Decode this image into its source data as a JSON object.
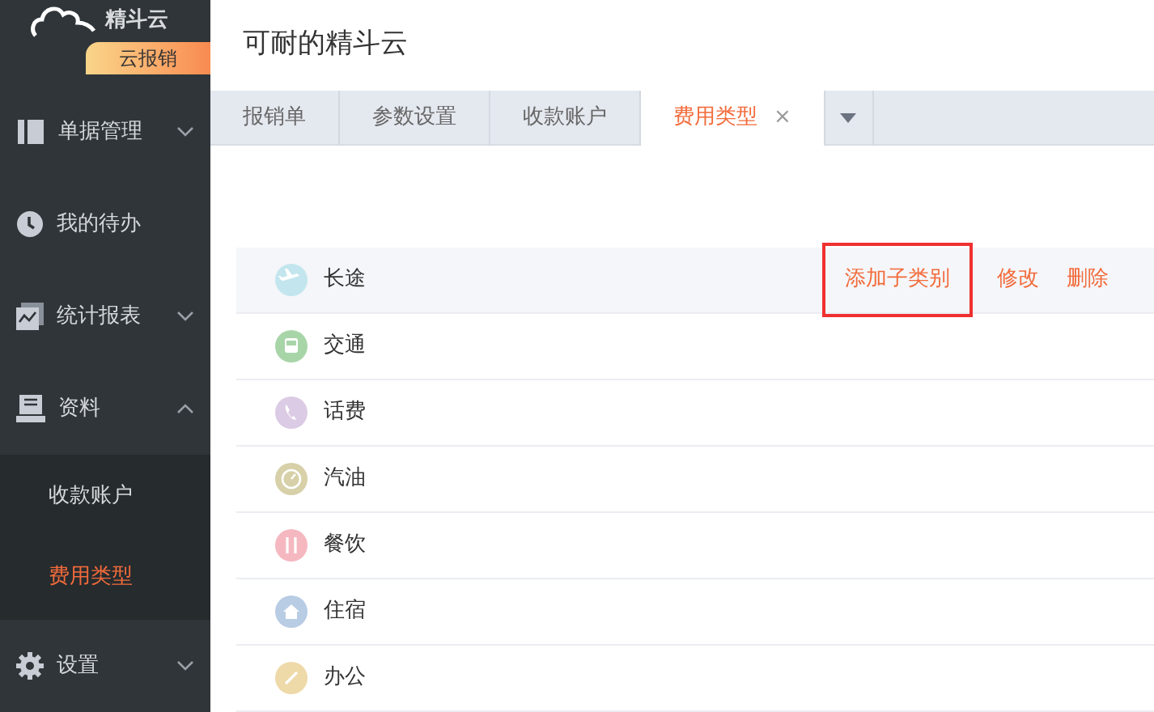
{
  "sidebar": {
    "logo": "精斗云",
    "badge": "云报销",
    "items": [
      {
        "label": "单据管理",
        "expanded": false
      },
      {
        "label": "我的待办"
      },
      {
        "label": "统计报表",
        "expanded": false
      },
      {
        "label": "资料",
        "expanded": true,
        "children": [
          {
            "label": "收款账户",
            "selected": false
          },
          {
            "label": "费用类型",
            "selected": true
          }
        ]
      },
      {
        "label": "设置",
        "expanded": false
      }
    ]
  },
  "header": {
    "title": "可耐的精斗云"
  },
  "tabs": [
    {
      "label": "报销单",
      "selected": false
    },
    {
      "label": "参数设置",
      "selected": false
    },
    {
      "label": "收款账户",
      "selected": false
    },
    {
      "label": "费用类型",
      "selected": true,
      "close": "×"
    }
  ],
  "categories": {
    "row_actions": [
      {
        "label": "添加子类别",
        "highlighted": true
      },
      {
        "label": "修改",
        "highlighted": false
      },
      {
        "label": "删除",
        "highlighted": false
      }
    ],
    "items": [
      {
        "label": "长途",
        "color": "#c3e6ee",
        "selected": true
      },
      {
        "label": "交通",
        "color": "#a8d5a8",
        "selected": false
      },
      {
        "label": "话费",
        "color": "#dccbe4",
        "selected": false
      },
      {
        "label": "汽油",
        "color": "#d7d0a8",
        "selected": false
      },
      {
        "label": "餐饮",
        "color": "#f5b8c0",
        "selected": false
      },
      {
        "label": "住宿",
        "color": "#b8cce4",
        "selected": false
      },
      {
        "label": "办公",
        "color": "#eed9a8",
        "selected": false
      }
    ]
  }
}
